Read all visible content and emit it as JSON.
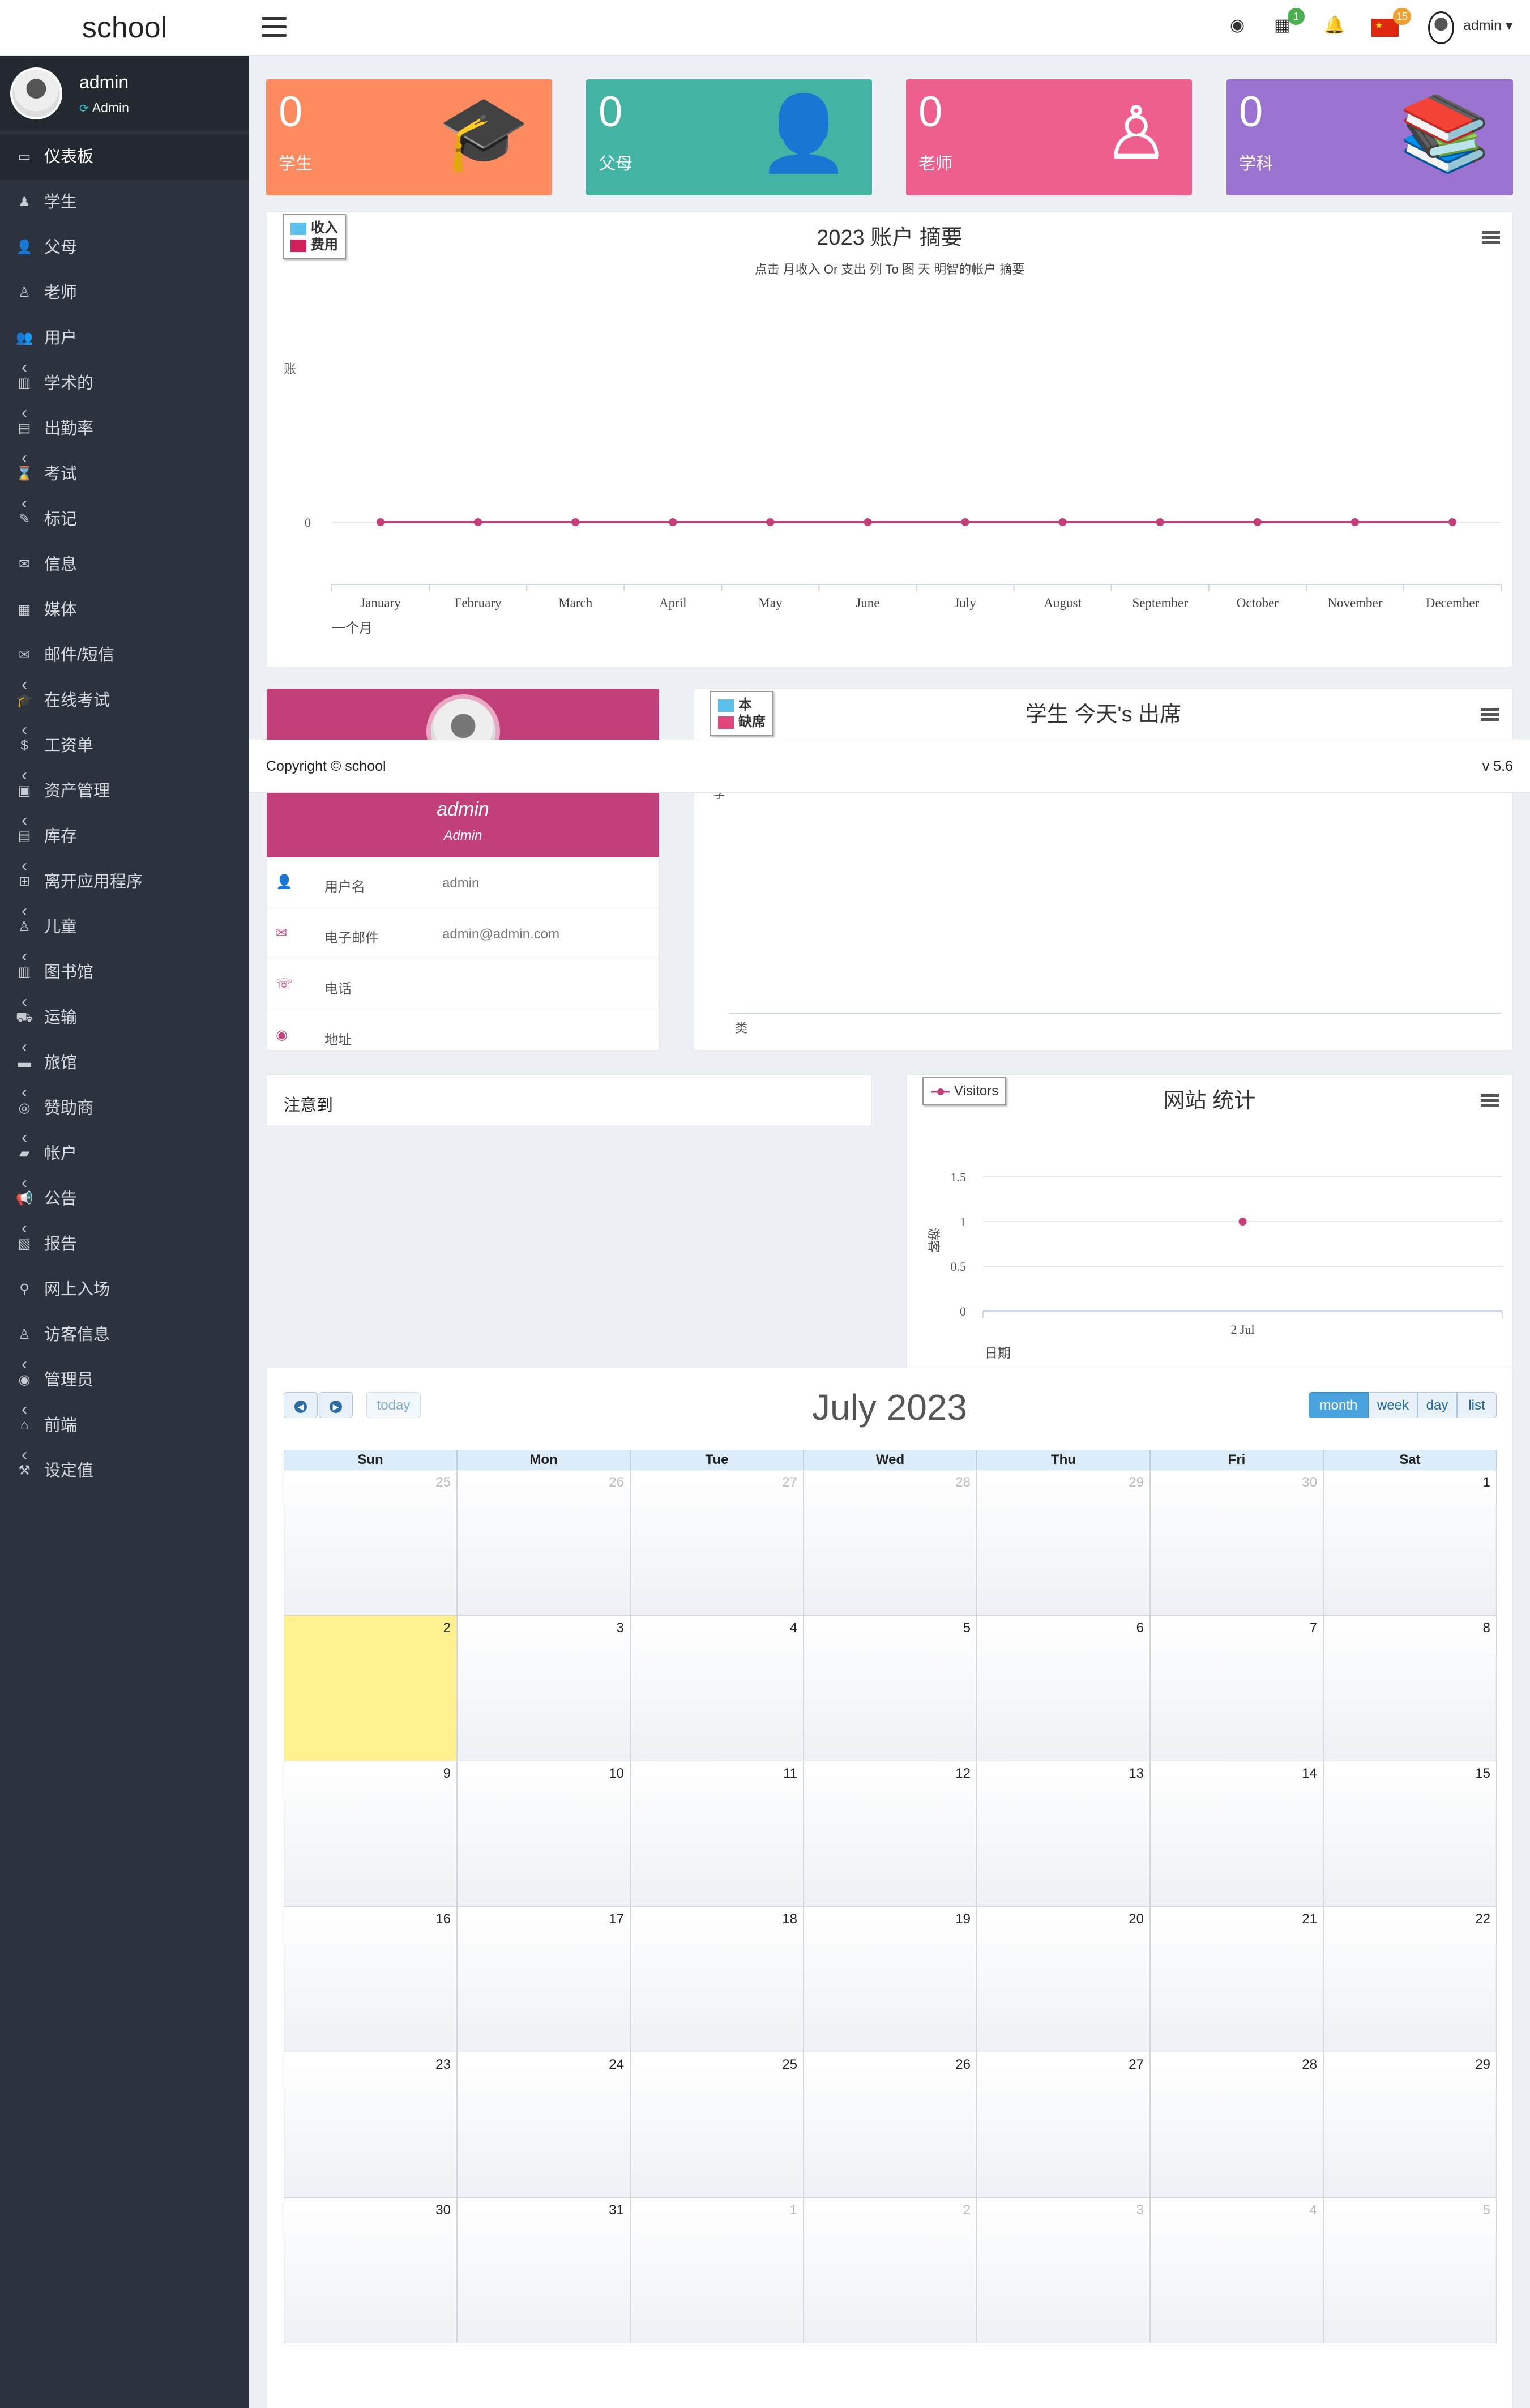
{
  "header": {
    "app_name": "school",
    "calendar_badge": "1",
    "language_badge": "15",
    "user_name": "admin"
  },
  "sidebar": {
    "user_name": "admin",
    "user_role": "Admin",
    "items": [
      {
        "label": "仪表板",
        "icon": "laptop-icon",
        "glyph": "▭",
        "active": true,
        "submenu": false
      },
      {
        "label": "学生",
        "icon": "student-icon",
        "glyph": "♟",
        "submenu": false
      },
      {
        "label": "父母",
        "icon": "parent-icon",
        "glyph": "👤",
        "submenu": false
      },
      {
        "label": "老师",
        "icon": "teacher-icon",
        "glyph": "♙",
        "submenu": false
      },
      {
        "label": "用户",
        "icon": "users-icon",
        "glyph": "👥",
        "submenu": false
      },
      {
        "label": "学术的",
        "icon": "academic-icon",
        "glyph": "▥",
        "submenu": true
      },
      {
        "label": "出勤率",
        "icon": "clipboard-icon",
        "glyph": "▤",
        "submenu": true
      },
      {
        "label": "考试",
        "icon": "hourglass-icon",
        "glyph": "⌛",
        "submenu": true
      },
      {
        "label": "标记",
        "icon": "edit-icon",
        "glyph": "✎",
        "submenu": true
      },
      {
        "label": "信息",
        "icon": "envelope-icon",
        "glyph": "✉",
        "submenu": false
      },
      {
        "label": "媒体",
        "icon": "film-icon",
        "glyph": "▦",
        "submenu": false
      },
      {
        "label": "邮件/短信",
        "icon": "inbox-icon",
        "glyph": "✉",
        "submenu": false
      },
      {
        "label": "在线考试",
        "icon": "graduation-cap-icon",
        "glyph": "🎓",
        "submenu": true
      },
      {
        "label": "工资单",
        "icon": "dollar-icon",
        "glyph": "$",
        "submenu": true
      },
      {
        "label": "资产管理",
        "icon": "archive-icon",
        "glyph": "▣",
        "submenu": true
      },
      {
        "label": "库存",
        "icon": "stock-icon",
        "glyph": "▤",
        "submenu": true
      },
      {
        "label": "离开应用程序",
        "icon": "leave-icon",
        "glyph": "⊞",
        "submenu": true
      },
      {
        "label": "儿童",
        "icon": "child-icon",
        "glyph": "♙",
        "submenu": true
      },
      {
        "label": "图书馆",
        "icon": "library-icon",
        "glyph": "▥",
        "submenu": true
      },
      {
        "label": "运输",
        "icon": "bus-icon",
        "glyph": "⛟",
        "submenu": true
      },
      {
        "label": "旅馆",
        "icon": "bed-icon",
        "glyph": "▬",
        "submenu": true
      },
      {
        "label": "赞助商",
        "icon": "sponsor-icon",
        "glyph": "◎",
        "submenu": true
      },
      {
        "label": "帐户",
        "icon": "money-icon",
        "glyph": "▰",
        "submenu": true
      },
      {
        "label": "公告",
        "icon": "bullhorn-icon",
        "glyph": "📢",
        "submenu": true
      },
      {
        "label": "报告",
        "icon": "report-icon",
        "glyph": "▧",
        "submenu": true
      },
      {
        "label": "网上入场",
        "icon": "sitemap-icon",
        "glyph": "⚲",
        "submenu": false
      },
      {
        "label": "访客信息",
        "icon": "visitor-icon",
        "glyph": "♙",
        "submenu": false
      },
      {
        "label": "管理员",
        "icon": "admin-icon",
        "glyph": "◉",
        "submenu": true
      },
      {
        "label": "前端",
        "icon": "home-icon",
        "glyph": "⌂",
        "submenu": true
      },
      {
        "label": "设定值",
        "icon": "gavel-icon",
        "glyph": "⚒",
        "submenu": true
      }
    ]
  },
  "stats": [
    {
      "value": "0",
      "label": "学生",
      "icon": "graduate-icon",
      "color": "#fe8a5f"
    },
    {
      "value": "0",
      "label": "父母",
      "icon": "user-icon",
      "color": "#43b3a4"
    },
    {
      "value": "0",
      "label": "老师",
      "icon": "teacher-laptop-icon",
      "color": "#ef5f8e"
    },
    {
      "value": "0",
      "label": "学科",
      "icon": "books-icon",
      "color": "#9b72cf"
    }
  ],
  "account_chart": {
    "title": "2023 账户 摘要",
    "subtitle": "点击 月收入 Or 支出 列 To 图 天 明智的帐户 摘要",
    "ylabel": "账",
    "xlabel": "一个月",
    "legend": [
      {
        "name": "收入",
        "color": "#5bc0eb"
      },
      {
        "name": "费用",
        "color": "#d0215c"
      }
    ],
    "chart_data": {
      "type": "line",
      "categories": [
        "January",
        "February",
        "March",
        "April",
        "May",
        "June",
        "July",
        "August",
        "September",
        "October",
        "November",
        "December"
      ],
      "series": [
        {
          "name": "收入",
          "values": [
            0,
            0,
            0,
            0,
            0,
            0,
            0,
            0,
            0,
            0,
            0,
            0
          ]
        },
        {
          "name": "费用",
          "values": [
            0,
            0,
            0,
            0,
            0,
            0,
            0,
            0,
            0,
            0,
            0,
            0
          ]
        }
      ],
      "y_tick": "0",
      "line_color": "#c2407a"
    }
  },
  "profile": {
    "name": "admin",
    "role": "Admin",
    "rows": [
      {
        "key": "用户名",
        "value": "admin",
        "icon": "user-icon"
      },
      {
        "key": "电子邮件",
        "value": "admin@admin.com",
        "icon": "envelope-icon"
      },
      {
        "key": "电话",
        "value": "",
        "icon": "phone-icon"
      },
      {
        "key": "地址",
        "value": "",
        "icon": "globe-icon"
      }
    ]
  },
  "attendance_chart": {
    "title": "学生 今天's 出席",
    "legend": [
      {
        "name": "本",
        "color": "#5bc0eb"
      },
      {
        "name": "缺席",
        "color": "#e0477a"
      }
    ],
    "xlabel": "类",
    "y_tick": "学"
  },
  "notice": {
    "title": "注意到"
  },
  "visitor_chart": {
    "title": "网站 统计",
    "legend": "Visitors",
    "ylabel": "游客",
    "xlabel": "日期",
    "chart_data": {
      "type": "line",
      "x": [
        "2 Jul"
      ],
      "series": [
        {
          "name": "Visitors",
          "values": [
            1
          ]
        }
      ],
      "ylim": [
        0,
        1.5
      ],
      "y_ticks": [
        "0",
        "0.5",
        "1",
        "1.5"
      ],
      "color": "#c2407a"
    }
  },
  "footer": {
    "copyright": "Copyright © school",
    "version": "v 5.6"
  },
  "calendar": {
    "title": "July 2023",
    "today_label": "today",
    "views": [
      "month",
      "week",
      "day",
      "list"
    ],
    "active_view": "month",
    "weekdays": [
      "Sun",
      "Mon",
      "Tue",
      "Wed",
      "Thu",
      "Fri",
      "Sat"
    ],
    "weeks": [
      [
        "25",
        "26",
        "27",
        "28",
        "29",
        "30",
        "1"
      ],
      [
        "2",
        "3",
        "4",
        "5",
        "6",
        "7",
        "8"
      ],
      [
        "9",
        "10",
        "11",
        "12",
        "13",
        "14",
        "15"
      ],
      [
        "16",
        "17",
        "18",
        "19",
        "20",
        "21",
        "22"
      ],
      [
        "23",
        "24",
        "25",
        "26",
        "27",
        "28",
        "29"
      ],
      [
        "30",
        "31",
        "1",
        "2",
        "3",
        "4",
        "5"
      ]
    ],
    "today": "2"
  }
}
